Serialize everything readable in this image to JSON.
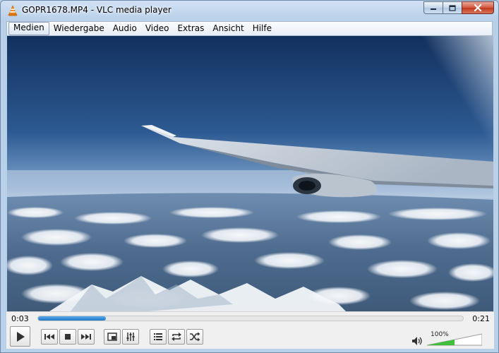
{
  "window": {
    "title": "GOPR1678.MP4 - VLC media player"
  },
  "menubar": {
    "items": [
      "Medien",
      "Wiedergabe",
      "Audio",
      "Video",
      "Extras",
      "Ansicht",
      "Hilfe"
    ],
    "active_index": 0
  },
  "player": {
    "elapsed": "0:03",
    "total": "0:21",
    "progress_fraction": 0.16,
    "volume_label": "100%",
    "volume_fraction": 0.5
  },
  "controls": {
    "icons": [
      "play-icon",
      "previous-icon",
      "stop-icon",
      "next-icon",
      "fullscreen-icon",
      "extended-settings-icon",
      "playlist-icon",
      "loop-icon",
      "shuffle-icon",
      "volume-icon"
    ]
  },
  "colors": {
    "accent": "#1f78c8",
    "volume_fill": "#3fbf3a"
  }
}
